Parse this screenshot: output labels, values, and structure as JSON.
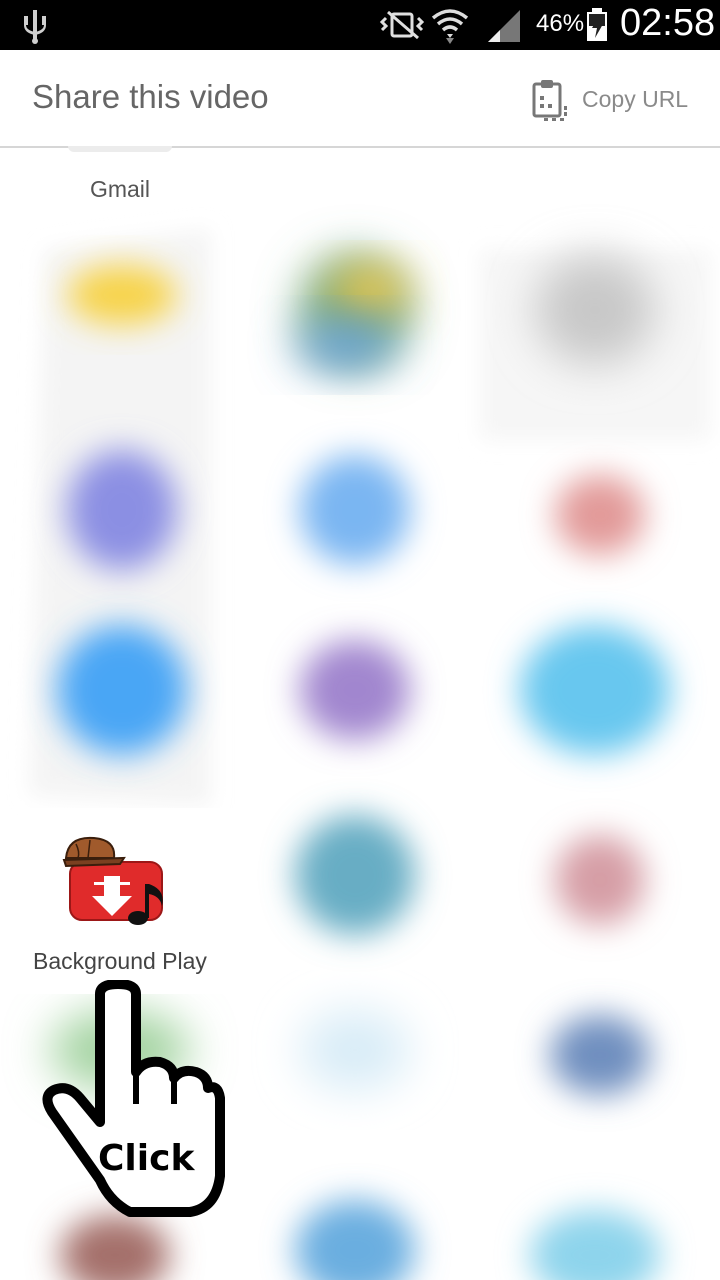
{
  "status_bar": {
    "battery_percent": "46%",
    "time": "02:58"
  },
  "header": {
    "title": "Share this video",
    "copy_url_label": "Copy URL"
  },
  "apps": {
    "gmail_label": "Gmail",
    "background_play_label": "Background Play"
  },
  "overlay": {
    "click_label": "Click"
  },
  "colors": {
    "status_bar_bg": "#000000",
    "header_title": "#666666",
    "copy_url": "#8a8a8a"
  }
}
